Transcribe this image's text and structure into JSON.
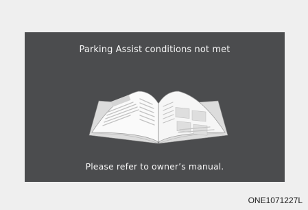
{
  "dialog": {
    "title": "Parking Assist conditions not met",
    "message": "Please refer to owner’s manual."
  },
  "figure_code": "ONE1071227L",
  "icons": {
    "manual": "open-book-icon"
  },
  "colors": {
    "page_background": "#efefef",
    "screen_background": "#4b4c4e",
    "text": "#f4f4f4"
  }
}
